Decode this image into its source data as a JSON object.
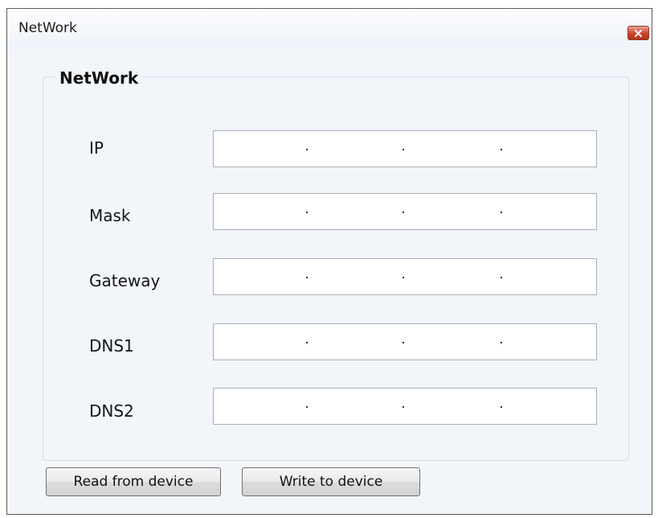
{
  "window": {
    "title": "NetWork",
    "close_icon": "close-icon"
  },
  "group": {
    "title": "NetWork"
  },
  "fields": [
    {
      "label": "IP",
      "value": ""
    },
    {
      "label": "Mask",
      "value": ""
    },
    {
      "label": "Gateway",
      "value": ""
    },
    {
      "label": "DNS1",
      "value": ""
    },
    {
      "label": "DNS2",
      "value": ""
    }
  ],
  "buttons": {
    "read_label": "Read from device",
    "write_label": "Write to device"
  },
  "colors": {
    "client_background": "#f2f5fa",
    "close_button_red": "#c8442b"
  }
}
